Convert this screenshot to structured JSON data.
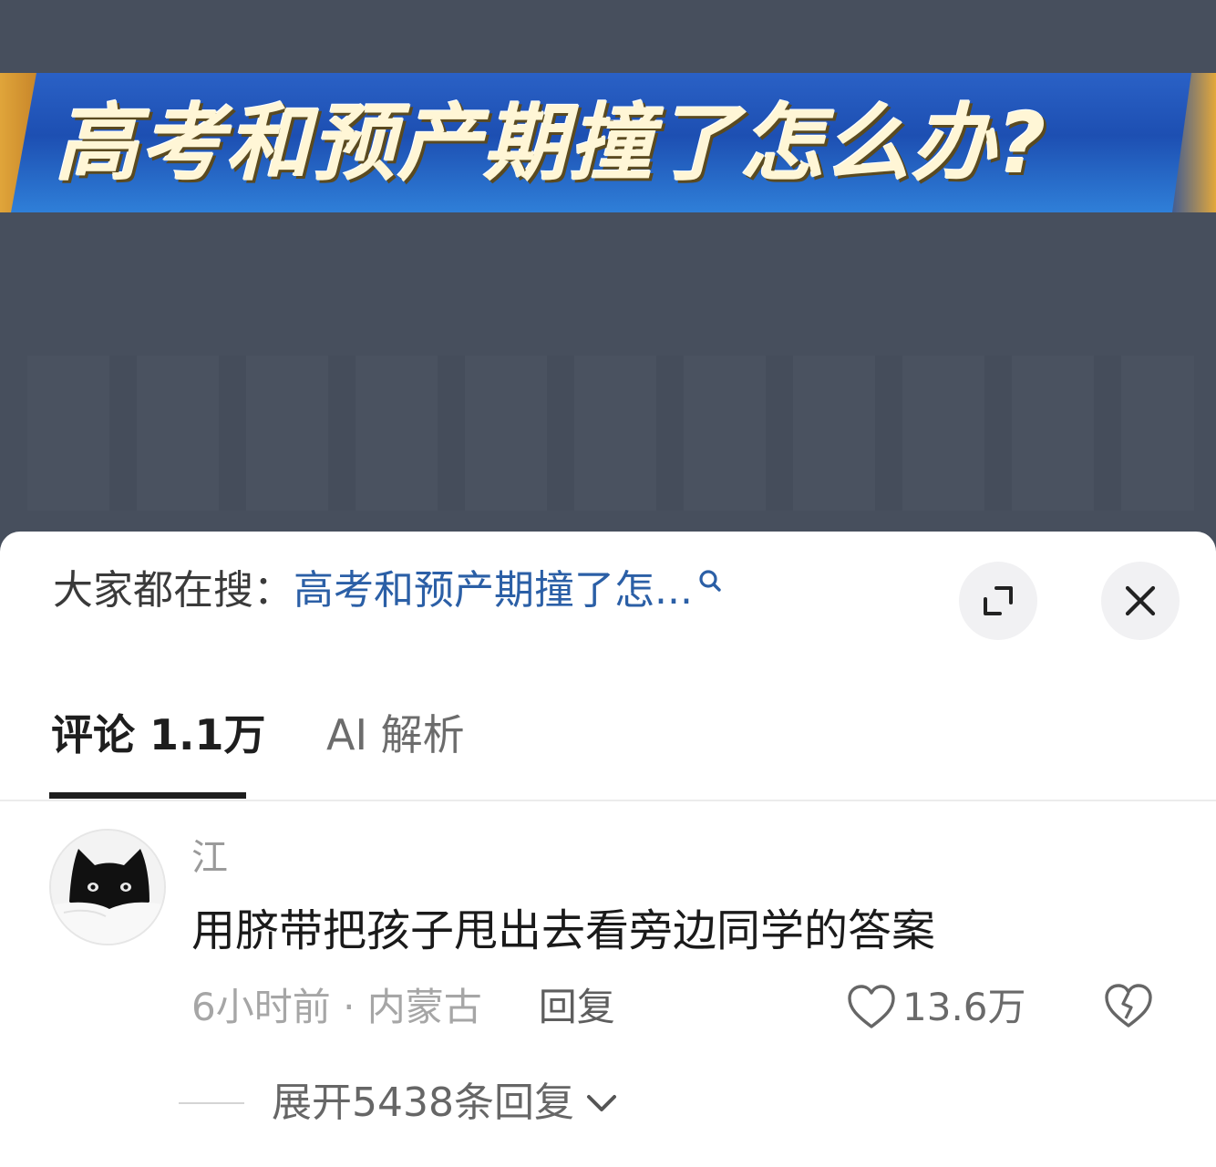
{
  "video": {
    "banner_title": "高考和预产期撞了怎么办?"
  },
  "search": {
    "prefix": "大家都在搜：",
    "query": "高考和预产期撞了怎...",
    "icon": "search-icon"
  },
  "controls": {
    "expand_icon": "expand-icon",
    "close_icon": "close-icon"
  },
  "tabs": [
    {
      "label": "评论 1.1万",
      "active": true
    },
    {
      "label": "AI 解析",
      "active": false
    }
  ],
  "comment": {
    "username": "江",
    "text": "用脐带把孩子甩出去看旁边同学的答案",
    "time_location": "6小时前 · 内蒙古",
    "reply_label": "回复",
    "like_count": "13.6万",
    "expand_replies": "展开5438条回复",
    "avatar": "black-cat-avatar"
  },
  "colors": {
    "accent_link": "#2b5fa6",
    "background_video": "#474f5d",
    "banner_blue": "#1d4fb2",
    "banner_text": "#fff6d6"
  }
}
